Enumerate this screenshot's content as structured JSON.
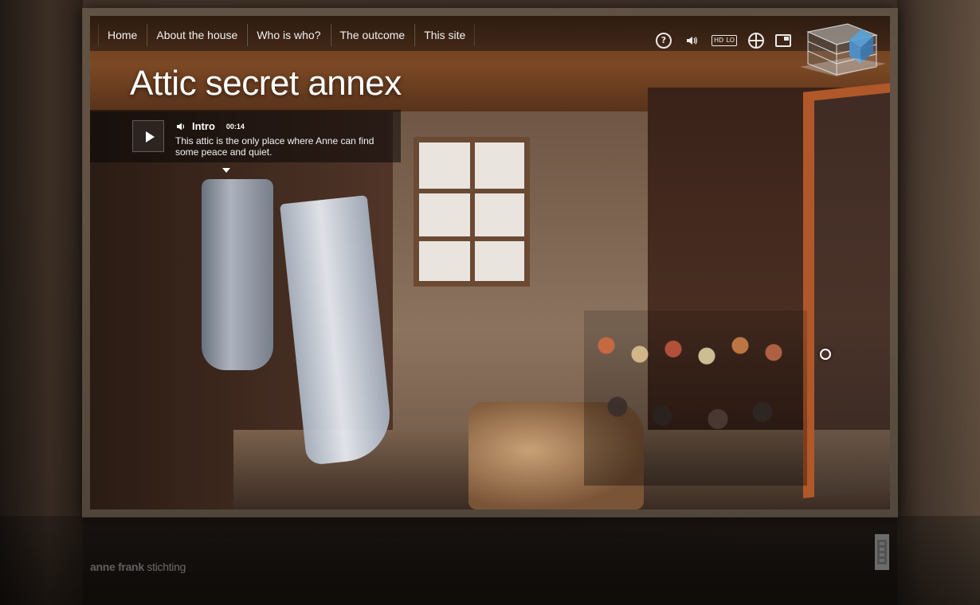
{
  "nav": {
    "items": [
      {
        "label": "Home"
      },
      {
        "label": "About the house"
      },
      {
        "label": "Who is who?"
      },
      {
        "label": "The outcome"
      },
      {
        "label": "This site"
      }
    ],
    "icons": [
      {
        "name": "help-icon",
        "glyph": "?"
      },
      {
        "name": "sound-icon",
        "glyph": "🔊"
      },
      {
        "name": "quality-toggle-icon",
        "hd": "HD",
        "lo": "LO"
      },
      {
        "name": "language-globe-icon"
      },
      {
        "name": "fullscreen-icon"
      }
    ]
  },
  "page": {
    "title": "Attic secret annex"
  },
  "intro": {
    "label": "Intro",
    "duration": "00:14",
    "text": "This attic is the only place where Anne can find some peace and quiet."
  },
  "footer": {
    "brand_bold": "anne frank",
    "brand_light": "stichting"
  },
  "colors": {
    "text": "#ffffff",
    "door_accent": "#b0582a",
    "nav_bg": "#1a130f"
  }
}
